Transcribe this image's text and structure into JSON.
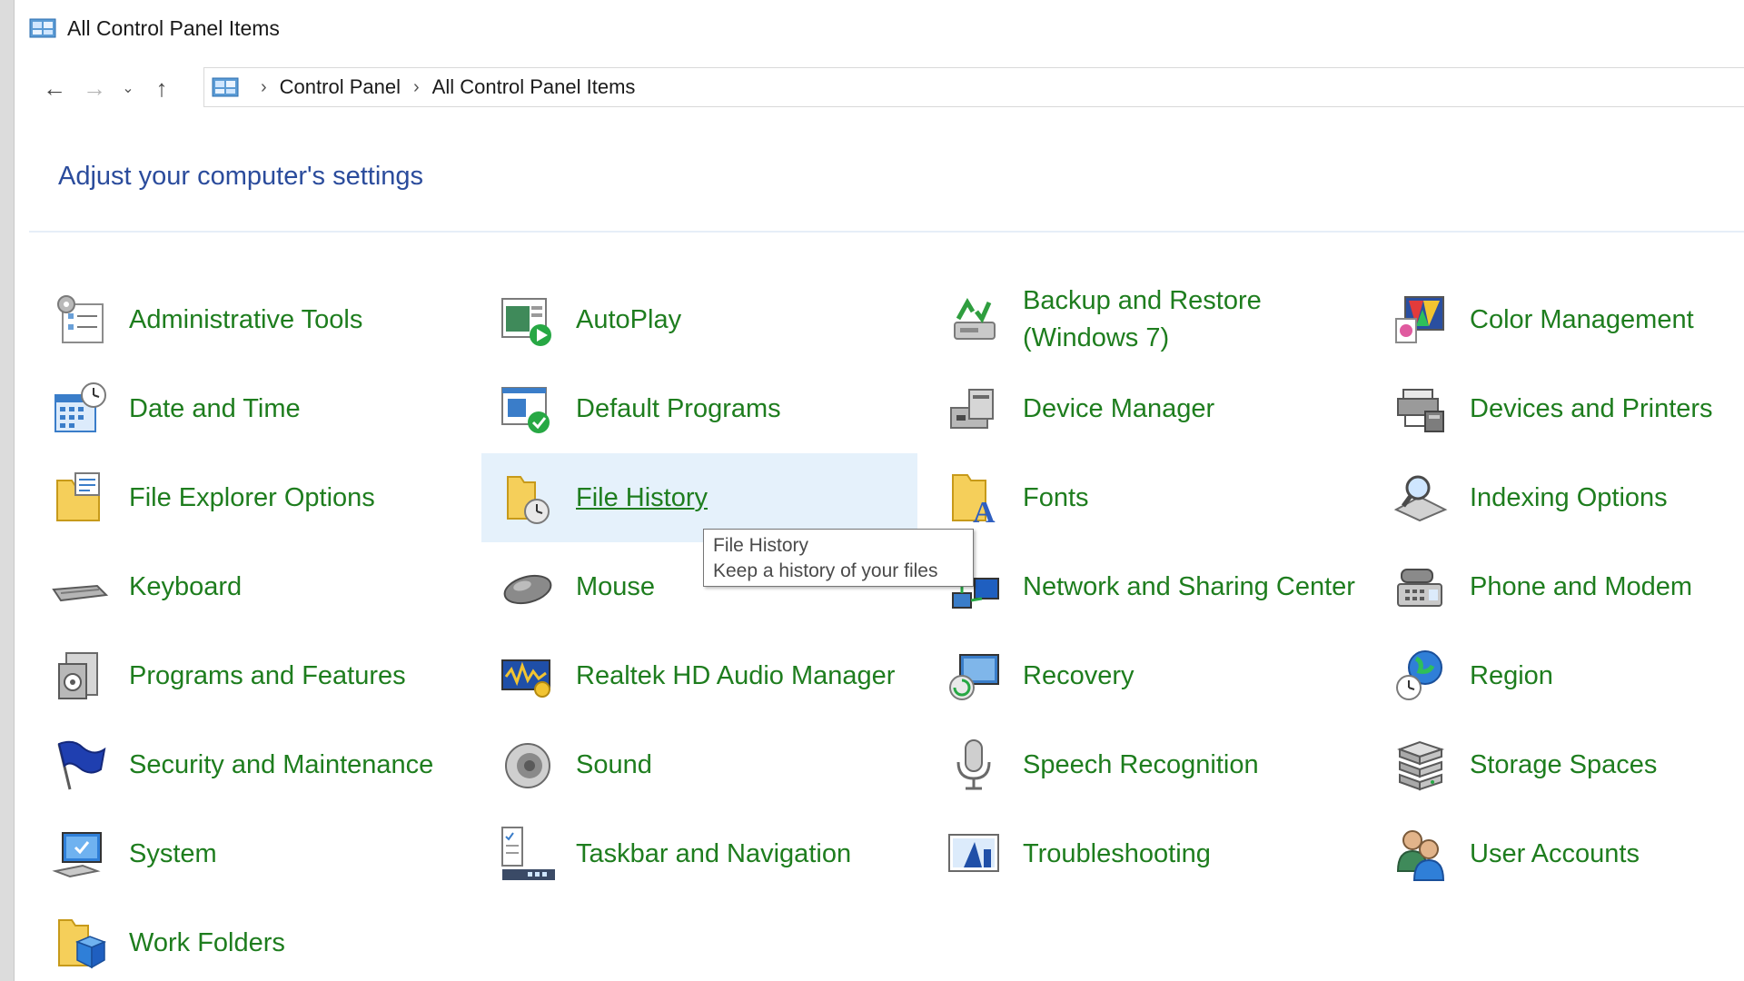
{
  "window": {
    "title": "All Control Panel Items"
  },
  "nav": {
    "back_icon": "←",
    "forward_icon": "→",
    "recent_icon": "⌄",
    "up_icon": "↑"
  },
  "breadcrumb": {
    "sep": "›",
    "items": [
      "Control Panel",
      "All Control Panel Items"
    ]
  },
  "page": {
    "heading": "Adjust your computer's settings"
  },
  "items": [
    {
      "label": "Administrative Tools",
      "icon": "admin-tools-icon"
    },
    {
      "label": "AutoPlay",
      "icon": "autoplay-icon"
    },
    {
      "label": "Backup and Restore (Windows 7)",
      "icon": "backup-restore-icon"
    },
    {
      "label": "Color Management",
      "icon": "color-management-icon"
    },
    {
      "label": "Date and Time",
      "icon": "date-time-icon"
    },
    {
      "label": "Default Programs",
      "icon": "default-programs-icon"
    },
    {
      "label": "Device Manager",
      "icon": "device-manager-icon"
    },
    {
      "label": "Devices and Printers",
      "icon": "devices-printers-icon"
    },
    {
      "label": "File Explorer Options",
      "icon": "file-explorer-options-icon"
    },
    {
      "label": "File History",
      "icon": "file-history-icon"
    },
    {
      "label": "Fonts",
      "icon": "fonts-icon"
    },
    {
      "label": "Indexing Options",
      "icon": "indexing-options-icon"
    },
    {
      "label": "Keyboard",
      "icon": "keyboard-icon"
    },
    {
      "label": "Mouse",
      "icon": "mouse-icon"
    },
    {
      "label": "Network and Sharing Center",
      "icon": "network-sharing-icon"
    },
    {
      "label": "Phone and Modem",
      "icon": "phone-modem-icon"
    },
    {
      "label": "Programs and Features",
      "icon": "programs-features-icon"
    },
    {
      "label": "Realtek HD Audio Manager",
      "icon": "realtek-audio-icon"
    },
    {
      "label": "Recovery",
      "icon": "recovery-icon"
    },
    {
      "label": "Region",
      "icon": "region-icon"
    },
    {
      "label": "Security and Maintenance",
      "icon": "security-maintenance-icon"
    },
    {
      "label": "Sound",
      "icon": "sound-icon"
    },
    {
      "label": "Speech Recognition",
      "icon": "speech-recognition-icon"
    },
    {
      "label": "Storage Spaces",
      "icon": "storage-spaces-icon"
    },
    {
      "label": "System",
      "icon": "system-icon"
    },
    {
      "label": "Taskbar and Navigation",
      "icon": "taskbar-navigation-icon"
    },
    {
      "label": "Troubleshooting",
      "icon": "troubleshooting-icon"
    },
    {
      "label": "User Accounts",
      "icon": "user-accounts-icon"
    },
    {
      "label": "Work Folders",
      "icon": "work-folders-icon"
    }
  ],
  "tooltip": {
    "title": "File History",
    "description": "Keep a history of your files"
  },
  "colors": {
    "link": "#1e7d1e",
    "heading": "#2b4c9c",
    "hover_bg": "#e5f1fb"
  }
}
